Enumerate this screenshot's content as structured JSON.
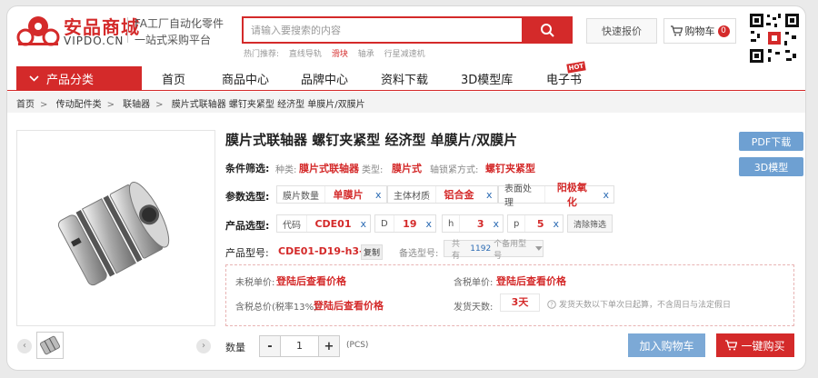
{
  "brand": {
    "cn": "安品商城",
    "en": "VIPDO.CN",
    "tagline1": "FA工厂自动化零件",
    "tagline2": "一站式采购平台"
  },
  "search": {
    "placeholder": "请输入要搜索的内容"
  },
  "hot_search": {
    "label": "热门推荐:",
    "items": [
      "直线导轨",
      "滑块",
      "轴承",
      "行星减速机"
    ]
  },
  "header": {
    "quick_quote": "快速报价",
    "cart_label": "购物车",
    "cart_count": "0"
  },
  "nav": {
    "category_label": "产品分类",
    "items": [
      "首页",
      "商品中心",
      "品牌中心",
      "资料下载",
      "3D模型库",
      "电子书"
    ],
    "hot_badge": "HOT"
  },
  "breadcrumb": [
    "首页",
    "传动配件类",
    "联轴器",
    "膜片式联轴器 螺钉夹紧型 经济型 单膜片/双膜片"
  ],
  "product": {
    "title": "膜片式联轴器 螺钉夹紧型 经济型 单膜片/双膜片",
    "pdf_button": "PDF下载",
    "model3d_button": "3D模型",
    "filter": {
      "label": "条件筛选:",
      "type_key": "种类:",
      "type_val": "膜片式联轴器",
      "kind_key": "类型:",
      "kind_val": "膜片式",
      "lock_key": "轴锁紧方式:",
      "lock_val": "螺钉夹紧型"
    },
    "params": {
      "label": "参数选型:",
      "chips": [
        {
          "key": "膜片数量",
          "value": "单膜片"
        },
        {
          "key": "主体材质",
          "value": "铝合金"
        },
        {
          "key": "表面处理",
          "value": "阳极氧化"
        }
      ]
    },
    "selection": {
      "label": "产品选型:",
      "code_key": "代码",
      "code_val": "CDE01",
      "d_key": "D",
      "d_val": "19",
      "h_key": "h",
      "h_val": "3",
      "p_key": "p",
      "p_val": "5",
      "clear": "清除筛选"
    },
    "model": {
      "label": "产品型号:",
      "value": "CDE01-D19-h3-p5",
      "copy": "复制",
      "alt_label": "备选型号:",
      "alt_prefix": "共有",
      "alt_count": "1192",
      "alt_suffix": "个备用型号"
    },
    "price": {
      "untaxed_label": "未税单价:",
      "untaxed_val": "登陆后查看价格",
      "taxed_label": "含税单价:",
      "taxed_val": "登陆后查看价格",
      "total_label": "含税总价(税率13%):",
      "total_val": "登陆后查看价格",
      "ship_label": "发货天数:",
      "ship_val": "3天",
      "ship_note": "发货天数以下单次日起算，不含周日与法定假日"
    },
    "quantity": {
      "label": "数量",
      "minus": "-",
      "value": "1",
      "plus": "+",
      "unit": "(PCS)"
    },
    "add_to_cart": "加入购物车",
    "buy_now": "一键购买"
  },
  "colors": {
    "brand_red": "#d42a2a",
    "blue_button": "#6ea0d2",
    "link_blue": "#2a6ab3"
  }
}
